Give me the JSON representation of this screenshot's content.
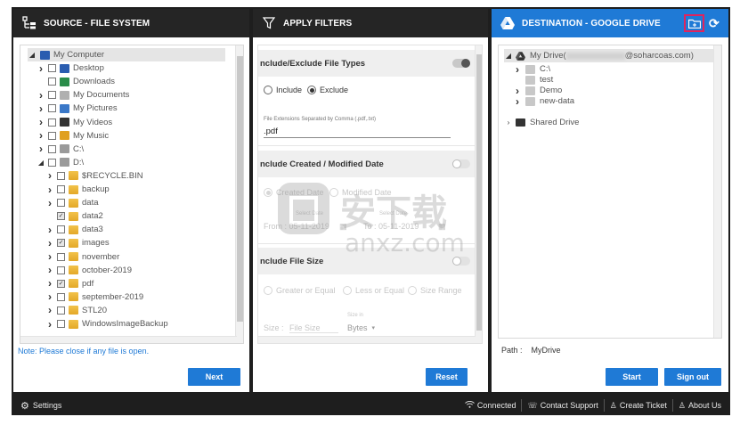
{
  "source": {
    "title": "SOURCE - FILE SYSTEM",
    "tree": [
      {
        "label": "My Computer",
        "level": 0,
        "expand": "open",
        "check": false,
        "icon": "computer-icon",
        "checkbox": false,
        "selected": true
      },
      {
        "label": "Desktop",
        "level": 1,
        "expand": "closed",
        "check": false,
        "icon": "desktop-icon"
      },
      {
        "label": "Downloads",
        "level": 1,
        "expand": "none",
        "check": false,
        "icon": "downloads-icon"
      },
      {
        "label": "My Documents",
        "level": 1,
        "expand": "closed",
        "check": false,
        "icon": "documents-icon"
      },
      {
        "label": "My Pictures",
        "level": 1,
        "expand": "closed",
        "check": false,
        "icon": "pictures-icon"
      },
      {
        "label": "My Videos",
        "level": 1,
        "expand": "closed",
        "check": false,
        "icon": "videos-icon"
      },
      {
        "label": "My Music",
        "level": 1,
        "expand": "closed",
        "check": false,
        "icon": "music-icon"
      },
      {
        "label": "C:\\",
        "level": 1,
        "expand": "closed",
        "check": false,
        "icon": "drive-icon"
      },
      {
        "label": "D:\\",
        "level": 1,
        "expand": "open",
        "check": false,
        "icon": "drive-icon"
      },
      {
        "label": "$RECYCLE.BIN",
        "level": 2,
        "expand": "closed",
        "check": false,
        "icon": "folder-icon"
      },
      {
        "label": "backup",
        "level": 2,
        "expand": "closed",
        "check": false,
        "icon": "folder-icon"
      },
      {
        "label": "data",
        "level": 2,
        "expand": "closed",
        "check": false,
        "icon": "folder-icon"
      },
      {
        "label": "data2",
        "level": 2,
        "expand": "none",
        "check": true,
        "icon": "folder-icon"
      },
      {
        "label": "data3",
        "level": 2,
        "expand": "closed",
        "check": false,
        "icon": "folder-icon"
      },
      {
        "label": "images",
        "level": 2,
        "expand": "closed",
        "check": true,
        "icon": "folder-icon"
      },
      {
        "label": "november",
        "level": 2,
        "expand": "closed",
        "check": false,
        "icon": "folder-icon"
      },
      {
        "label": "october-2019",
        "level": 2,
        "expand": "closed",
        "check": false,
        "icon": "folder-icon"
      },
      {
        "label": "pdf",
        "level": 2,
        "expand": "closed",
        "check": true,
        "icon": "folder-icon"
      },
      {
        "label": "september-2019",
        "level": 2,
        "expand": "closed",
        "check": false,
        "icon": "folder-icon"
      },
      {
        "label": "STL20",
        "level": 2,
        "expand": "closed",
        "check": false,
        "icon": "folder-icon"
      },
      {
        "label": "WindowsImageBackup",
        "level": 2,
        "expand": "closed",
        "check": false,
        "icon": "folder-icon"
      }
    ],
    "note": "Note: Please close if any file is open.",
    "next_label": "Next"
  },
  "filters": {
    "title": "APPLY FILTERS",
    "types": {
      "header": "nclude/Exclude File Types",
      "include_label": "Include",
      "exclude_label": "Exclude",
      "selected": "exclude",
      "ext_caption": "File Extensions Separated by Comma (.pdf,.txt)",
      "ext_value": ".pdf",
      "enabled": true
    },
    "dates": {
      "header": "nclude Created / Modified Date",
      "created_label": "Created Date",
      "modified_label": "Modified Date",
      "select_date_caption": "Select Date",
      "from_label": "From :",
      "from_value": "05-11-2019",
      "to_label": "To :",
      "to_value": "05-11-2019",
      "enabled": false
    },
    "size": {
      "header": "nclude File Size",
      "opt1": "Greater or Equal",
      "opt2": "Less or Equal",
      "opt3": "Size Range",
      "size_label": "Size :",
      "size_placeholder": "File Size",
      "size_in_caption": "Size in",
      "unit": "Bytes",
      "enabled": false
    },
    "reset_label": "Reset"
  },
  "destination": {
    "title": "DESTINATION - GOOGLE DRIVE",
    "root_prefix": "My Drive(",
    "root_suffix": "@soharcoas.com)",
    "tree": [
      {
        "label": "C:\\",
        "level": 1,
        "expand": "closed"
      },
      {
        "label": "test",
        "level": 1,
        "expand": "none"
      },
      {
        "label": "Demo",
        "level": 1,
        "expand": "closed"
      },
      {
        "label": "new-data",
        "level": 1,
        "expand": "closed"
      }
    ],
    "shared_label": "Shared Drive",
    "path_label": "Path :",
    "path_value": "MyDrive",
    "start_label": "Start",
    "signout_label": "Sign out"
  },
  "footer": {
    "settings": "Settings",
    "connected": "Connected",
    "support": "Contact Support",
    "ticket": "Create Ticket",
    "about": "About Us"
  },
  "watermark": {
    "text": "anxz.com"
  },
  "colors": {
    "accent": "#1f7ad6",
    "header_dark": "#252525",
    "highlight_border": "#e0245e"
  }
}
